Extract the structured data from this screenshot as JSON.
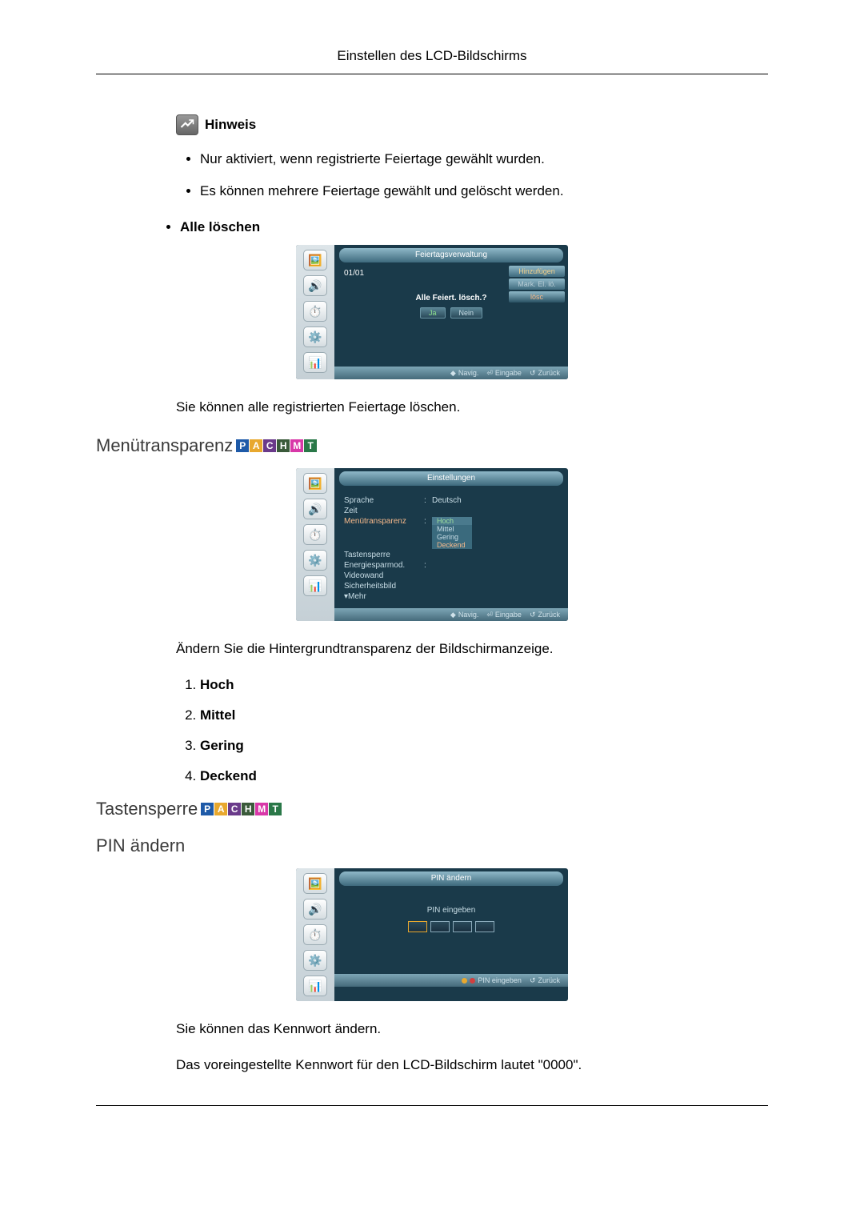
{
  "header": {
    "title": "Einstellen des LCD-Bildschirms"
  },
  "note": {
    "label": "Hinweis"
  },
  "bullets": {
    "b1": "Nur aktiviert, wenn registrierte Feiertage gewählt wurden.",
    "b2": "Es können mehrere Feiertage gewählt und gelöscht werden."
  },
  "deleteAll": {
    "label": "Alle löschen"
  },
  "osd1": {
    "title": "Feiertagsverwaltung",
    "date": "01/01",
    "menu": {
      "add": "Hinzufügen",
      "mark": "Mark. El. lö.",
      "del": "lösc"
    },
    "dialog": {
      "title": "Alle Feiert. lösch.?",
      "yes": "Ja",
      "no": "Nein"
    },
    "footer": {
      "nav": "Navig.",
      "enter": "Eingabe",
      "back": "Zurück"
    }
  },
  "text1": "Sie können alle registrierten Feiertage löschen.",
  "section2": {
    "title": "Menütransparenz"
  },
  "osd2": {
    "title": "Einstellungen",
    "rows": {
      "lang_l": "Sprache",
      "lang_v": "Deutsch",
      "time_l": "Zeit",
      "trans_l": "Menütransparenz",
      "lock_l": "Tastensperre",
      "energy_l": "Energiesparmod.",
      "wall_l": "Videowand",
      "sec_l": "Sicherheitsbild",
      "more": "Mehr"
    },
    "opts": {
      "o1": "Hoch",
      "o2": "Mittel",
      "o3": "Gering",
      "o4": "Deckend"
    },
    "footer": {
      "nav": "Navig.",
      "enter": "Eingabe",
      "back": "Zurück"
    }
  },
  "text2": "Ändern Sie die Hintergrundtransparenz der Bildschirmanzeige.",
  "numlist": {
    "i1": "Hoch",
    "i2": "Mittel",
    "i3": "Gering",
    "i4": "Deckend"
  },
  "section3": {
    "title": "Tastensperre"
  },
  "section4": {
    "title": "PIN ändern"
  },
  "osd3": {
    "title": "PIN ändern",
    "label": "PIN eingeben",
    "footer": {
      "enter": "PIN eingeben",
      "back": "Zurück"
    }
  },
  "text3": "Sie können das Kennwort ändern.",
  "text4": "Das voreingestellte Kennwort für den LCD-Bildschirm lautet \"0000\"."
}
